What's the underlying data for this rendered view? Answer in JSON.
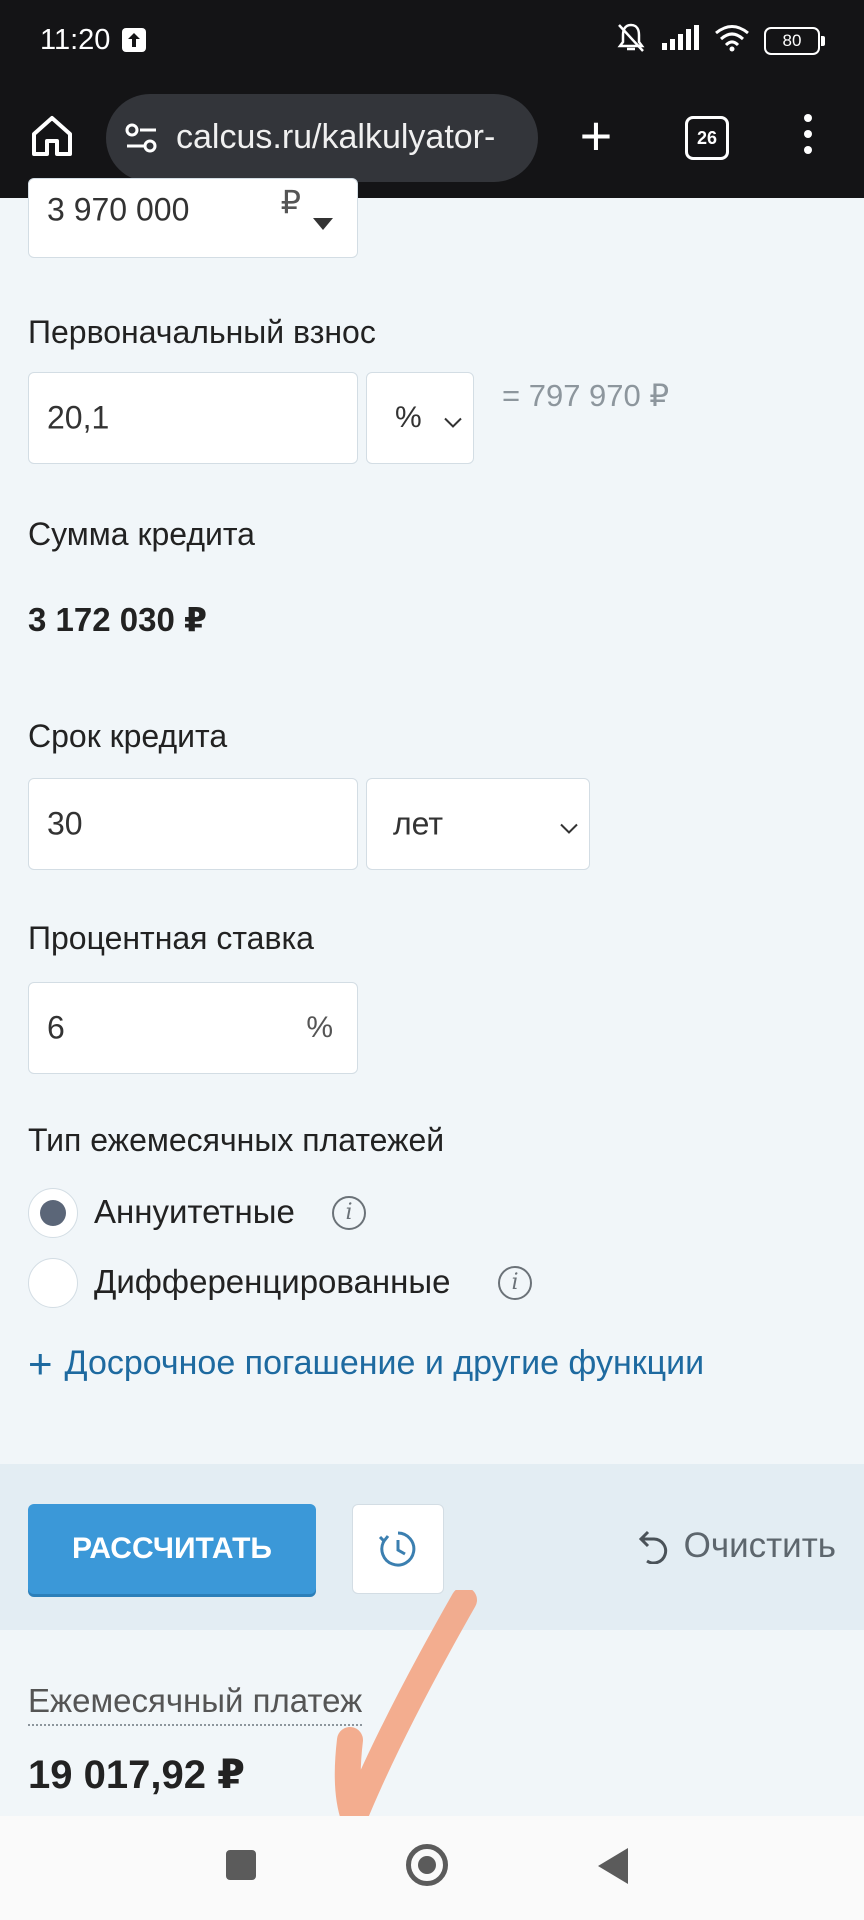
{
  "status_bar": {
    "time": "11:20",
    "battery": "80"
  },
  "browser": {
    "url": "calcus.ru/kalkulyator-",
    "tab_count": "26",
    "new_tab_label": "+"
  },
  "form": {
    "property_price": {
      "value": "3 970 000",
      "currency": "₽"
    },
    "down_payment": {
      "label": "Первоначальный взнос",
      "value": "20,1",
      "unit": "%",
      "equivalent": "= 797 970 ₽"
    },
    "loan_amount": {
      "label": "Сумма кредита",
      "value": "3 172 030 ₽"
    },
    "term": {
      "label": "Срок кредита",
      "value": "30",
      "unit": "лет"
    },
    "rate": {
      "label": "Процентная ставка",
      "value": "6",
      "unit": "%"
    },
    "payment_type": {
      "label": "Тип ежемесячных платежей",
      "options": [
        {
          "label": "Аннуитетные",
          "selected": true
        },
        {
          "label": "Дифференцированные",
          "selected": false
        }
      ]
    },
    "more_link": "Досрочное погашение и другие функции"
  },
  "actions": {
    "calculate": "РАССЧИТАТЬ",
    "clear": "Очистить"
  },
  "result": {
    "label": "Ежемесячный платеж",
    "value": "19 017,92 ₽"
  },
  "colors": {
    "accent": "#3b98d8",
    "link": "#1e6aa0",
    "annotation": "#f3a07c"
  }
}
